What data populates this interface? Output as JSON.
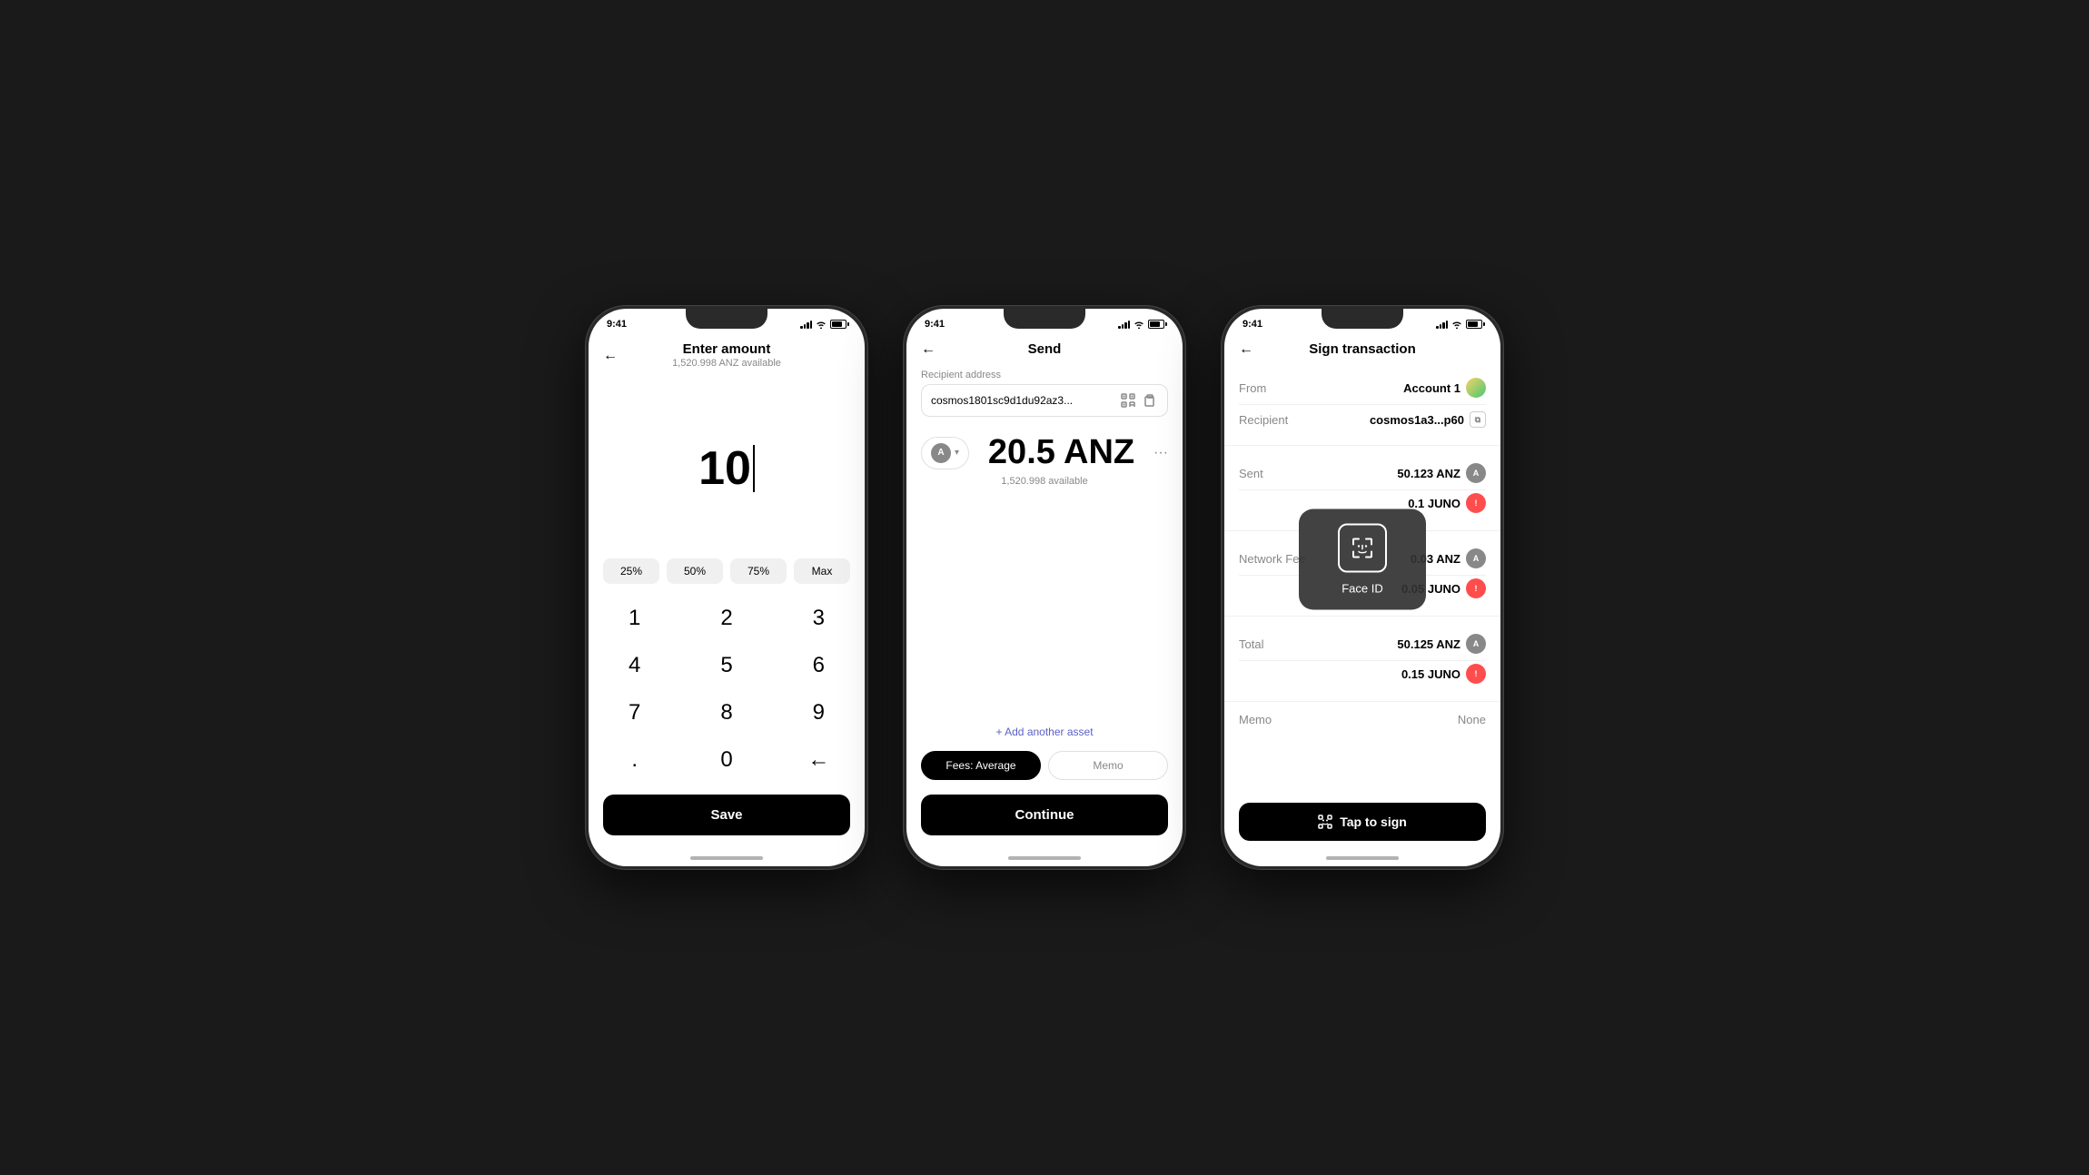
{
  "app": {
    "background": "#1a1a1a"
  },
  "phone1": {
    "statusBar": {
      "time": "9:41",
      "battery": "75"
    },
    "header": {
      "title": "Enter amount",
      "subtitle": "1,520.998 ANZ available",
      "backArrow": "←"
    },
    "amount": {
      "value": "10",
      "cursor": true
    },
    "percentButtons": [
      "25%",
      "50%",
      "75%",
      "Max"
    ],
    "numpad": [
      "1",
      "2",
      "3",
      "4",
      "5",
      "6",
      "7",
      "8",
      "9",
      ".",
      "0",
      "⌫"
    ],
    "saveButton": "Save"
  },
  "phone2": {
    "statusBar": {
      "time": "9:41"
    },
    "header": {
      "title": "Send",
      "backArrow": "←"
    },
    "recipientLabel": "Recipient address",
    "recipientAddress": "cosmos1801sc9d1du92az3...",
    "asset": {
      "symbol": "A",
      "amount": "20.5 ANZ",
      "available": "1,520.998 available"
    },
    "addAssetLabel": "+ Add another asset",
    "fees": {
      "average": "Fees: Average",
      "memo": "Memo"
    },
    "continueButton": "Continue"
  },
  "phone3": {
    "statusBar": {
      "time": "9:41"
    },
    "header": {
      "title": "Sign transaction",
      "backArrow": "←"
    },
    "from": {
      "label": "From",
      "value": "Account 1"
    },
    "recipient": {
      "label": "Recipient",
      "value": "cosmos1a3...p60"
    },
    "sent": {
      "label": "Sent",
      "anz": "50.123 ANZ",
      "juno": "0.1 JUNO"
    },
    "networkFee": {
      "label": "Network Fee",
      "anz": "0.03 ANZ",
      "juno": "0.05 JUNO"
    },
    "total": {
      "label": "Total",
      "anz": "50.125 ANZ",
      "juno": "0.15 JUNO"
    },
    "memo": {
      "label": "Memo",
      "value": "None"
    },
    "tapToSign": "Tap to sign",
    "faceId": {
      "label": "Face ID"
    }
  }
}
